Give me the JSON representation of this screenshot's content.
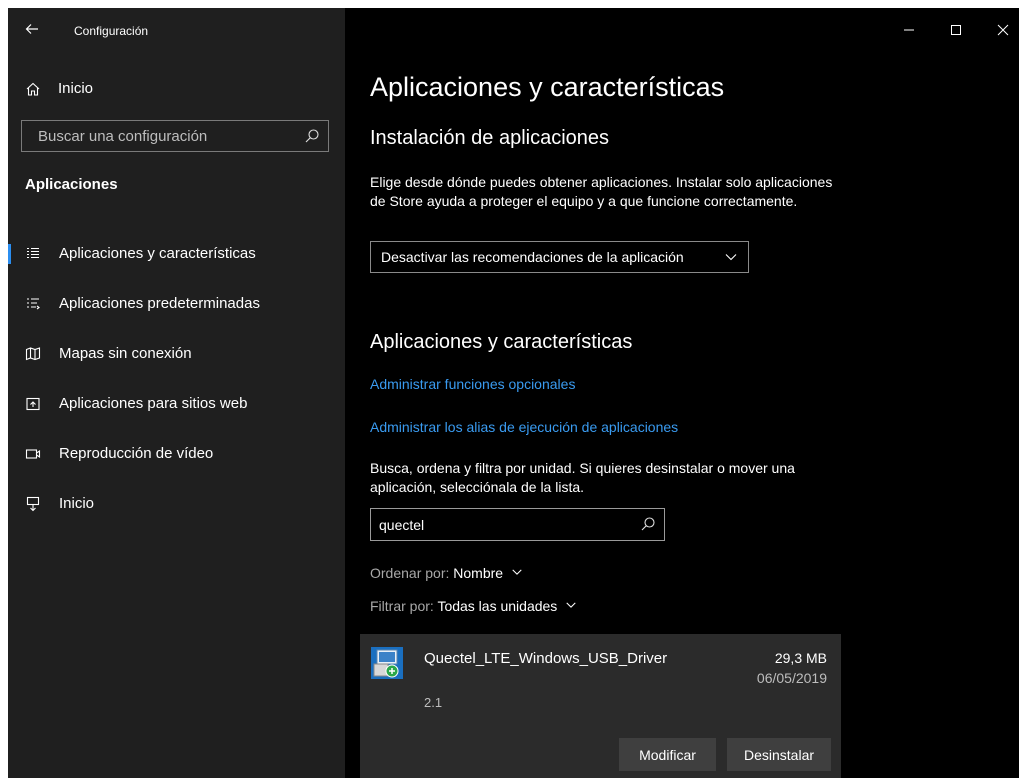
{
  "window": {
    "app_title": "Configuración",
    "back_icon": "arrow-left-icon",
    "controls": [
      "minimize-icon",
      "maximize-icon",
      "close-icon"
    ]
  },
  "sidebar": {
    "home_label": "Inicio",
    "search_placeholder": "Buscar una configuración",
    "section_heading": "Aplicaciones",
    "items": [
      {
        "label": "Aplicaciones y características",
        "icon": "apps-list-icon",
        "selected": true
      },
      {
        "label": "Aplicaciones predeterminadas",
        "icon": "default-apps-icon",
        "selected": false
      },
      {
        "label": "Mapas sin conexión",
        "icon": "offline-map-icon",
        "selected": false
      },
      {
        "label": "Aplicaciones para sitios web",
        "icon": "web-apps-icon",
        "selected": false
      },
      {
        "label": "Reproducción de vídeo",
        "icon": "video-icon",
        "selected": false
      },
      {
        "label": "Inicio",
        "icon": "startup-icon",
        "selected": false
      }
    ]
  },
  "main": {
    "page_title": "Aplicaciones y características",
    "install": {
      "heading": "Instalación de aplicaciones",
      "description": "Elige desde dónde puedes obtener aplicaciones. Instalar solo aplicaciones de Store ayuda a proteger el equipo y a que funcione correctamente.",
      "dropdown_value": "Desactivar las recomendaciones de la aplicación"
    },
    "apps_section": {
      "heading": "Aplicaciones y características",
      "link_optional": "Administrar funciones opcionales",
      "link_alias": "Administrar los alias de ejecución de aplicaciones",
      "description": "Busca, ordena y filtra por unidad. Si quieres desinstalar o mover una aplicación, selecciónala de la lista.",
      "search_value": "quectel",
      "sort_label": "Ordenar por:",
      "sort_value": "Nombre",
      "filter_label": "Filtrar por:",
      "filter_value": "Todas las unidades"
    },
    "app": {
      "name": "Quectel_LTE_Windows_USB_Driver",
      "size": "29,3 MB",
      "date": "06/05/2019",
      "version": "2.1",
      "icon": "installer-icon",
      "modify_label": "Modificar",
      "uninstall_label": "Desinstalar"
    }
  },
  "colors": {
    "sidebar_bg": "#1f1f1f",
    "main_bg": "#000000",
    "accent": "#2b8ef0",
    "link": "#3a9bf0",
    "card_bg": "#2b2b2b",
    "button_bg": "#3f3f3f"
  }
}
